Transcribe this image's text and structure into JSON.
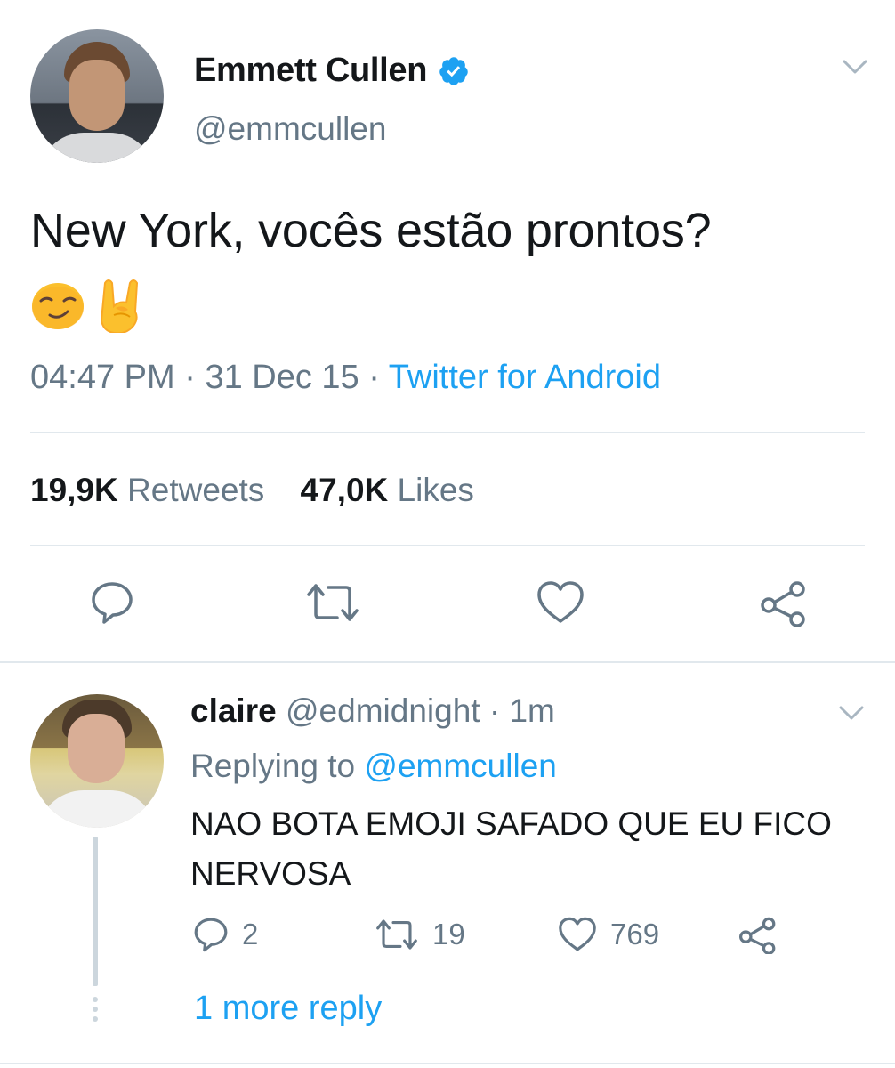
{
  "colors": {
    "text_primary": "#14171a",
    "text_secondary": "#657786",
    "link_blue": "#1da1f2",
    "divider": "#e1e8ed",
    "verified_blue": "#1da1f2"
  },
  "tweet": {
    "author": {
      "display_name": "Emmett Cullen",
      "handle": "@emmcullen",
      "verified": true,
      "avatar_icon": "user-photo-avatar"
    },
    "text": "New York, vocês estão prontos?",
    "emojis": [
      "smirking-face-emoji",
      "sign-of-the-horns-emoji"
    ],
    "time": "04:47 PM",
    "date": "31 Dec 15",
    "source": "Twitter for Android",
    "separator": "·",
    "stats": {
      "retweets_count": "19,9K",
      "retweets_label": "Retweets",
      "likes_count": "47,0K",
      "likes_label": "Likes"
    },
    "actions": [
      "reply-icon",
      "retweet-icon",
      "like-icon",
      "share-icon"
    ]
  },
  "reply": {
    "author": {
      "display_name": "claire",
      "handle": "@edmidnight",
      "avatar_icon": "user-photo-avatar"
    },
    "separator": "·",
    "age": "1m",
    "replying_prefix": "Replying to",
    "replying_to": "@emmcullen",
    "text": "NAO BOTA EMOJI SAFADO QUE EU FICO NERVOSA",
    "counts": {
      "replies": "2",
      "retweets": "19",
      "likes": "769"
    },
    "more_replies_label": "1 more reply"
  }
}
